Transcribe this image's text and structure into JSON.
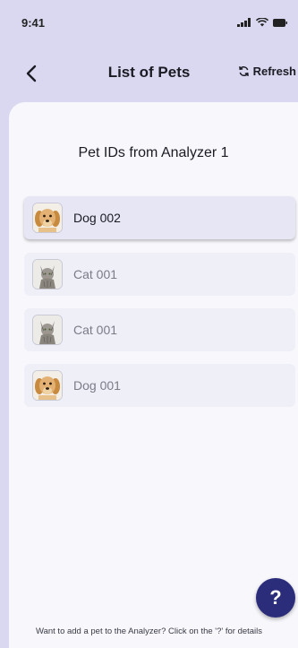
{
  "status_bar": {
    "time": "9:41"
  },
  "header": {
    "title": "List of Pets",
    "refresh_label": "Refresh"
  },
  "section": {
    "title": "Pet IDs from Analyzer 1"
  },
  "pets": [
    {
      "label": "Dog 002",
      "type": "dog",
      "selected": true
    },
    {
      "label": "Cat 001",
      "type": "cat",
      "selected": false
    },
    {
      "label": "Cat 001",
      "type": "cat",
      "selected": false
    },
    {
      "label": "Dog 001",
      "type": "dog",
      "selected": false
    }
  ],
  "help": {
    "label": "?"
  },
  "footer": {
    "text": "Want to add a pet to the Analyzer? Click on the '?' for details"
  },
  "colors": {
    "header_bg": "#d9d8f0",
    "sheet_bg": "#f8f8fc",
    "accent": "#2b2c7a"
  }
}
